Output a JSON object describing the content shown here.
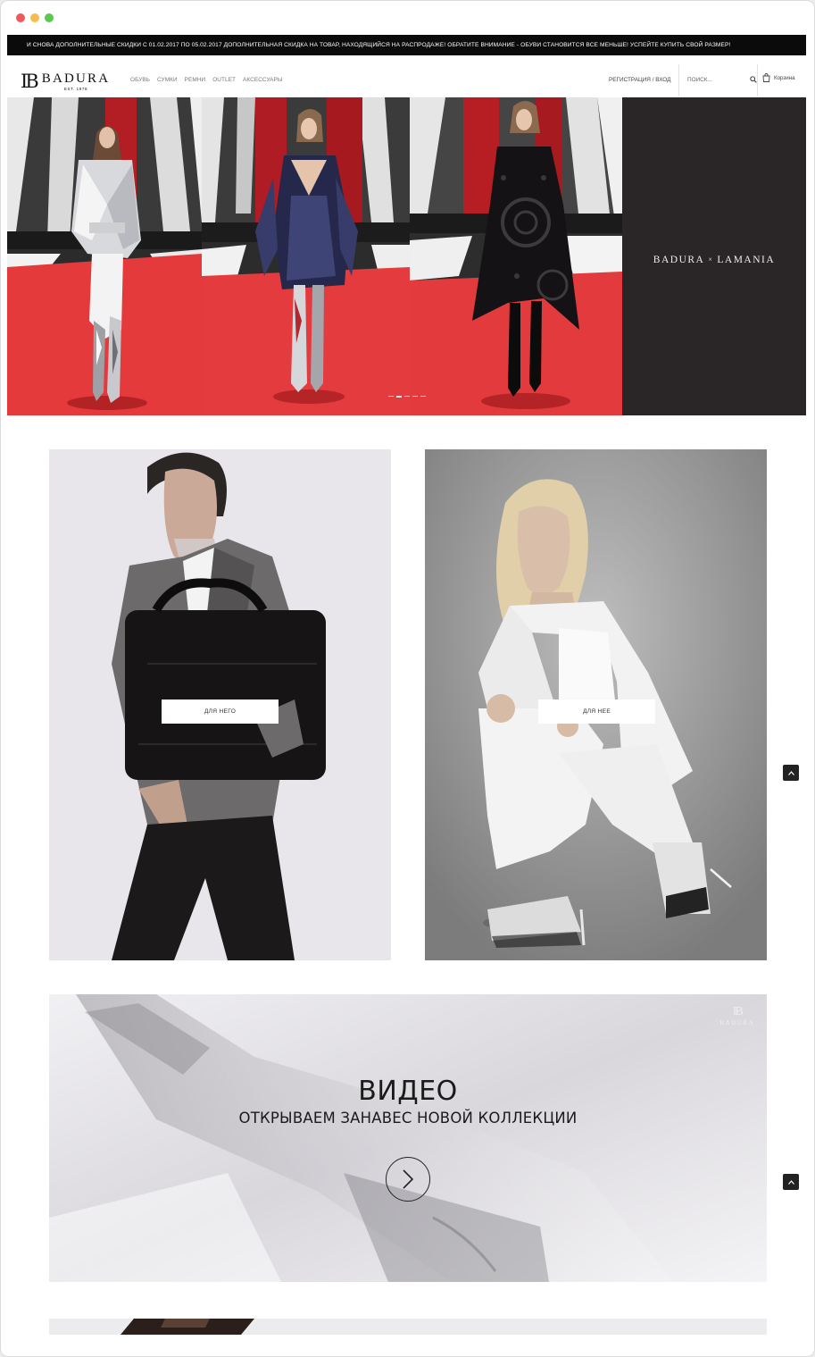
{
  "window": {
    "controls": [
      "close",
      "minimize",
      "maximize"
    ],
    "colors": {
      "close": "#ed5a5a",
      "minimize": "#f5bd4f",
      "maximize": "#5ec74f"
    }
  },
  "promo": {
    "text": "И СНОВА ДОПОЛНИТЕЛЬНЫЕ СКИДКИ С 01.02.2017 ПО 05.02.2017 ДОПОЛНИТЕЛЬНАЯ СКИДКА НА ТОВАР, НАХОДЯЩИЙСЯ НА РАСПРОДАЖЕ! ОБРАТИТЕ ВНИМАНИЕ - ОБУВИ СТАНОВИТСЯ ВСЕ МЕНЬШЕ! УСПЕЙТЕ КУПИТЬ СВОЙ РАЗМЕР!"
  },
  "header": {
    "logo": {
      "mark": "IB",
      "name": "BADURA",
      "est": "EST. 1978"
    },
    "nav": [
      "ОБУВЬ",
      "СУМКИ",
      "РЕМНИ",
      "OUTLET",
      "АКСЕССУАРЫ"
    ],
    "account": "РЕГИСТРАЦИЯ / ВХОД",
    "search": {
      "placeholder": "ПОИСК..."
    },
    "cart": "Корзина"
  },
  "hero": {
    "collab_left": "BADURA",
    "collab_x": "×",
    "collab_right": "LAMANIA",
    "slides_total": 5,
    "active_slide": 2,
    "colors": {
      "runway": "#e8383b",
      "backdrop": "#2a2628"
    }
  },
  "cards": {
    "him": {
      "button": "ДЛЯ НЕГО"
    },
    "her": {
      "button": "ДЛЯ НЕЕ"
    }
  },
  "video": {
    "title": "ВИДЕО",
    "subtitle": "ОТКРЫВАЕМ ЗАНАВЕС НОВОЙ КОЛЛЕКЦИИ",
    "watermark_mark": "IB",
    "watermark_name": "BADURA"
  }
}
